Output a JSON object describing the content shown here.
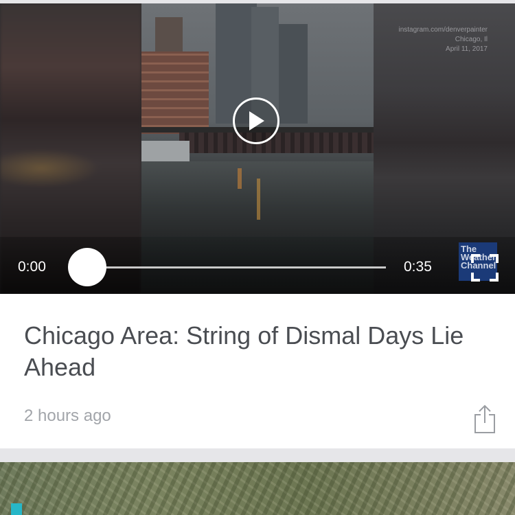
{
  "video": {
    "watermark_lines": [
      "instagram.com/denverpainter",
      "Chicago, Il",
      "April 11, 2017"
    ],
    "current_time": "0:00",
    "duration": "0:35",
    "progress": 0,
    "logo_text": "The Weather Channel",
    "play_icon": "play-icon",
    "fullscreen_icon": "fullscreen-icon"
  },
  "article": {
    "title": "Chicago Area: String of Dismal Days Lie Ahead",
    "time_ago": "2 hours ago",
    "share_icon": "share-icon"
  },
  "colors": {
    "title_text": "#4a4d52",
    "meta_text": "#a2a5aa",
    "page_bg": "#e6e6e9",
    "card_bg": "#ffffff"
  }
}
